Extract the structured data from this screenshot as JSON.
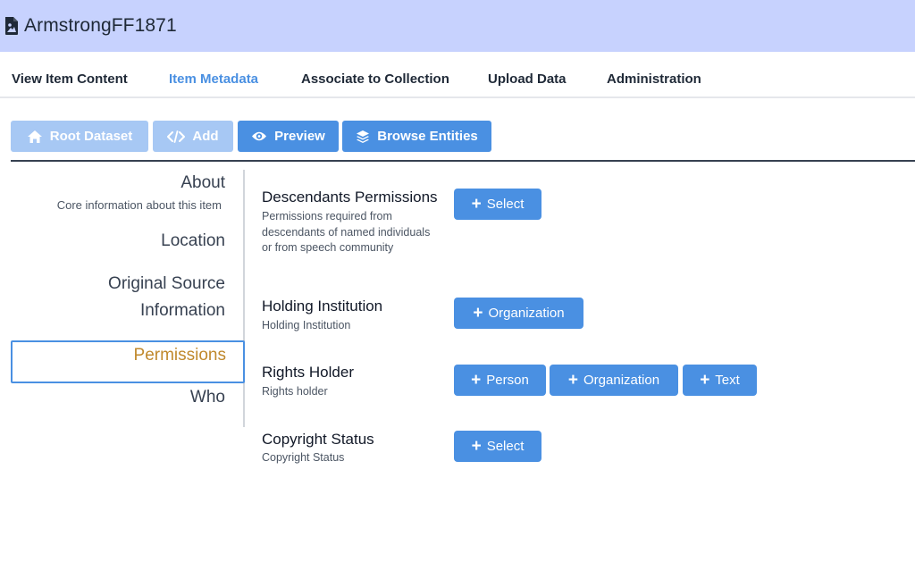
{
  "header": {
    "title": "ArmstrongFF1871",
    "icon": "file-image-icon",
    "bg_color": "#c7d2fe"
  },
  "tabs": [
    {
      "label": "View Item Content",
      "active": false
    },
    {
      "label": "Item Metadata",
      "active": true
    },
    {
      "label": "Associate to Collection",
      "active": false
    },
    {
      "label": "Upload Data",
      "active": false
    },
    {
      "label": "Administration",
      "active": false
    }
  ],
  "toolbar": {
    "root_label": "Root Dataset",
    "add_label": "Add",
    "preview_label": "Preview",
    "browse_label": "Browse Entities"
  },
  "sidebar": {
    "about": {
      "label": "About",
      "subtitle": "Core information about this item"
    },
    "location": "Location",
    "original_source_line1": "Original Source",
    "original_source_line2": "Information",
    "permissions": "Permissions",
    "who": "Who"
  },
  "fields": {
    "descendants": {
      "title": "Descendants Permissions",
      "description": "Permissions required from descendants of named individuals or from speech community",
      "button": "Select"
    },
    "holding": {
      "title": "Holding Institution",
      "description": "Holding Institution",
      "button": "Organization"
    },
    "rights": {
      "title": "Rights Holder",
      "description": "Rights holder",
      "buttons": {
        "person": "Person",
        "organization": "Organization",
        "text": "Text"
      }
    },
    "copyright": {
      "title": "Copyright Status",
      "description": "Copyright Status",
      "button": "Select"
    }
  },
  "colors": {
    "accent": "#4a90e2",
    "accent_disabled": "#a7c8f4",
    "active_nav_text": "#c0892d"
  }
}
